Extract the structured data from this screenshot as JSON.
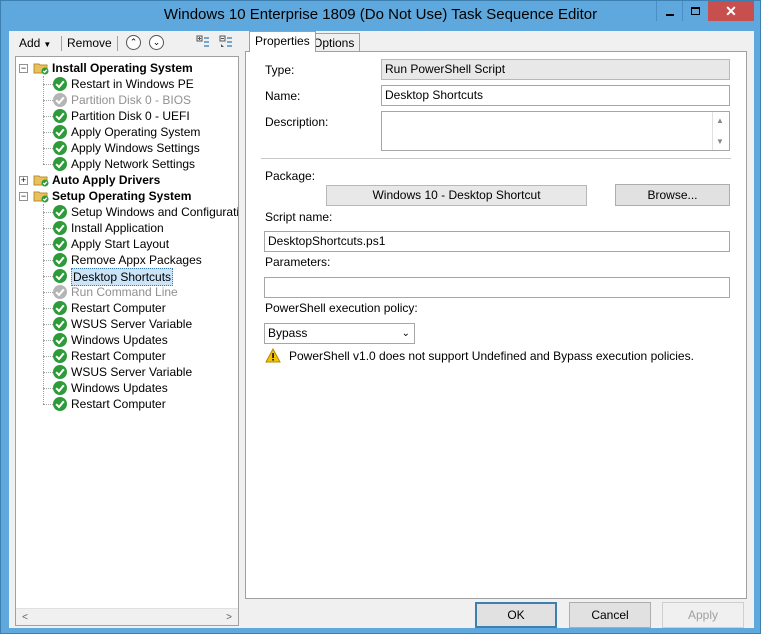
{
  "window": {
    "title": "Windows 10 Enterprise 1809 (Do Not Use) Task Sequence Editor",
    "minimize_icon": "minimize-icon",
    "maximize_icon": "maximize-icon",
    "close_icon": "close-icon"
  },
  "toolbar": {
    "add_label": "Add",
    "remove_label": "Remove",
    "icons": [
      "move-up-icon",
      "move-down-icon",
      "expand-all-icon",
      "collapse-all-icon"
    ]
  },
  "tree": {
    "groups": [
      {
        "label": "Install Operating System",
        "expanded": true,
        "children": [
          {
            "label": "Restart in Windows PE",
            "enabled": true
          },
          {
            "label": "Partition Disk 0 - BIOS",
            "enabled": false
          },
          {
            "label": "Partition Disk 0 - UEFI",
            "enabled": true
          },
          {
            "label": "Apply Operating System",
            "enabled": true
          },
          {
            "label": "Apply Windows Settings",
            "enabled": true
          },
          {
            "label": "Apply Network Settings",
            "enabled": true
          }
        ]
      },
      {
        "label": "Auto Apply Drivers",
        "expanded": false,
        "children": []
      },
      {
        "label": "Setup Operating System",
        "expanded": true,
        "children": [
          {
            "label": "Setup Windows and Configuration",
            "enabled": true
          },
          {
            "label": "Install Application",
            "enabled": true
          },
          {
            "label": "Apply Start Layout",
            "enabled": true
          },
          {
            "label": "Remove Appx Packages",
            "enabled": true
          },
          {
            "label": "Desktop Shortcuts",
            "enabled": true,
            "selected": true
          },
          {
            "label": "Run Command Line",
            "enabled": false
          },
          {
            "label": "Restart Computer",
            "enabled": true
          },
          {
            "label": "WSUS Server Variable",
            "enabled": true
          },
          {
            "label": "Windows Updates",
            "enabled": true
          },
          {
            "label": "Restart Computer",
            "enabled": true
          },
          {
            "label": "WSUS Server Variable",
            "enabled": true
          },
          {
            "label": "Windows Updates",
            "enabled": true
          },
          {
            "label": "Restart Computer",
            "enabled": true
          }
        ]
      }
    ]
  },
  "tabs": [
    "Properties",
    "Options"
  ],
  "properties": {
    "type_label": "Type:",
    "type_value": "Run PowerShell Script",
    "name_label": "Name:",
    "name_value": "Desktop Shortcuts",
    "description_label": "Description:",
    "description_value": "",
    "package_label": "Package:",
    "package_value": "Windows 10 - Desktop Shortcut",
    "browse_label": "Browse...",
    "script_name_label": "Script name:",
    "script_name_value": "DesktopShortcuts.ps1",
    "parameters_label": "Parameters:",
    "parameters_value": "",
    "policy_label": "PowerShell execution policy:",
    "policy_value": "Bypass",
    "warning_text": "PowerShell v1.0 does not support Undefined and Bypass execution policies."
  },
  "buttons": {
    "ok": "OK",
    "cancel": "Cancel",
    "apply": "Apply"
  },
  "colors": {
    "title_bar": "#5ea8dd",
    "close_button": "#c7504e",
    "success_check": "#2e9b3a",
    "selection": "#cce4f7"
  }
}
